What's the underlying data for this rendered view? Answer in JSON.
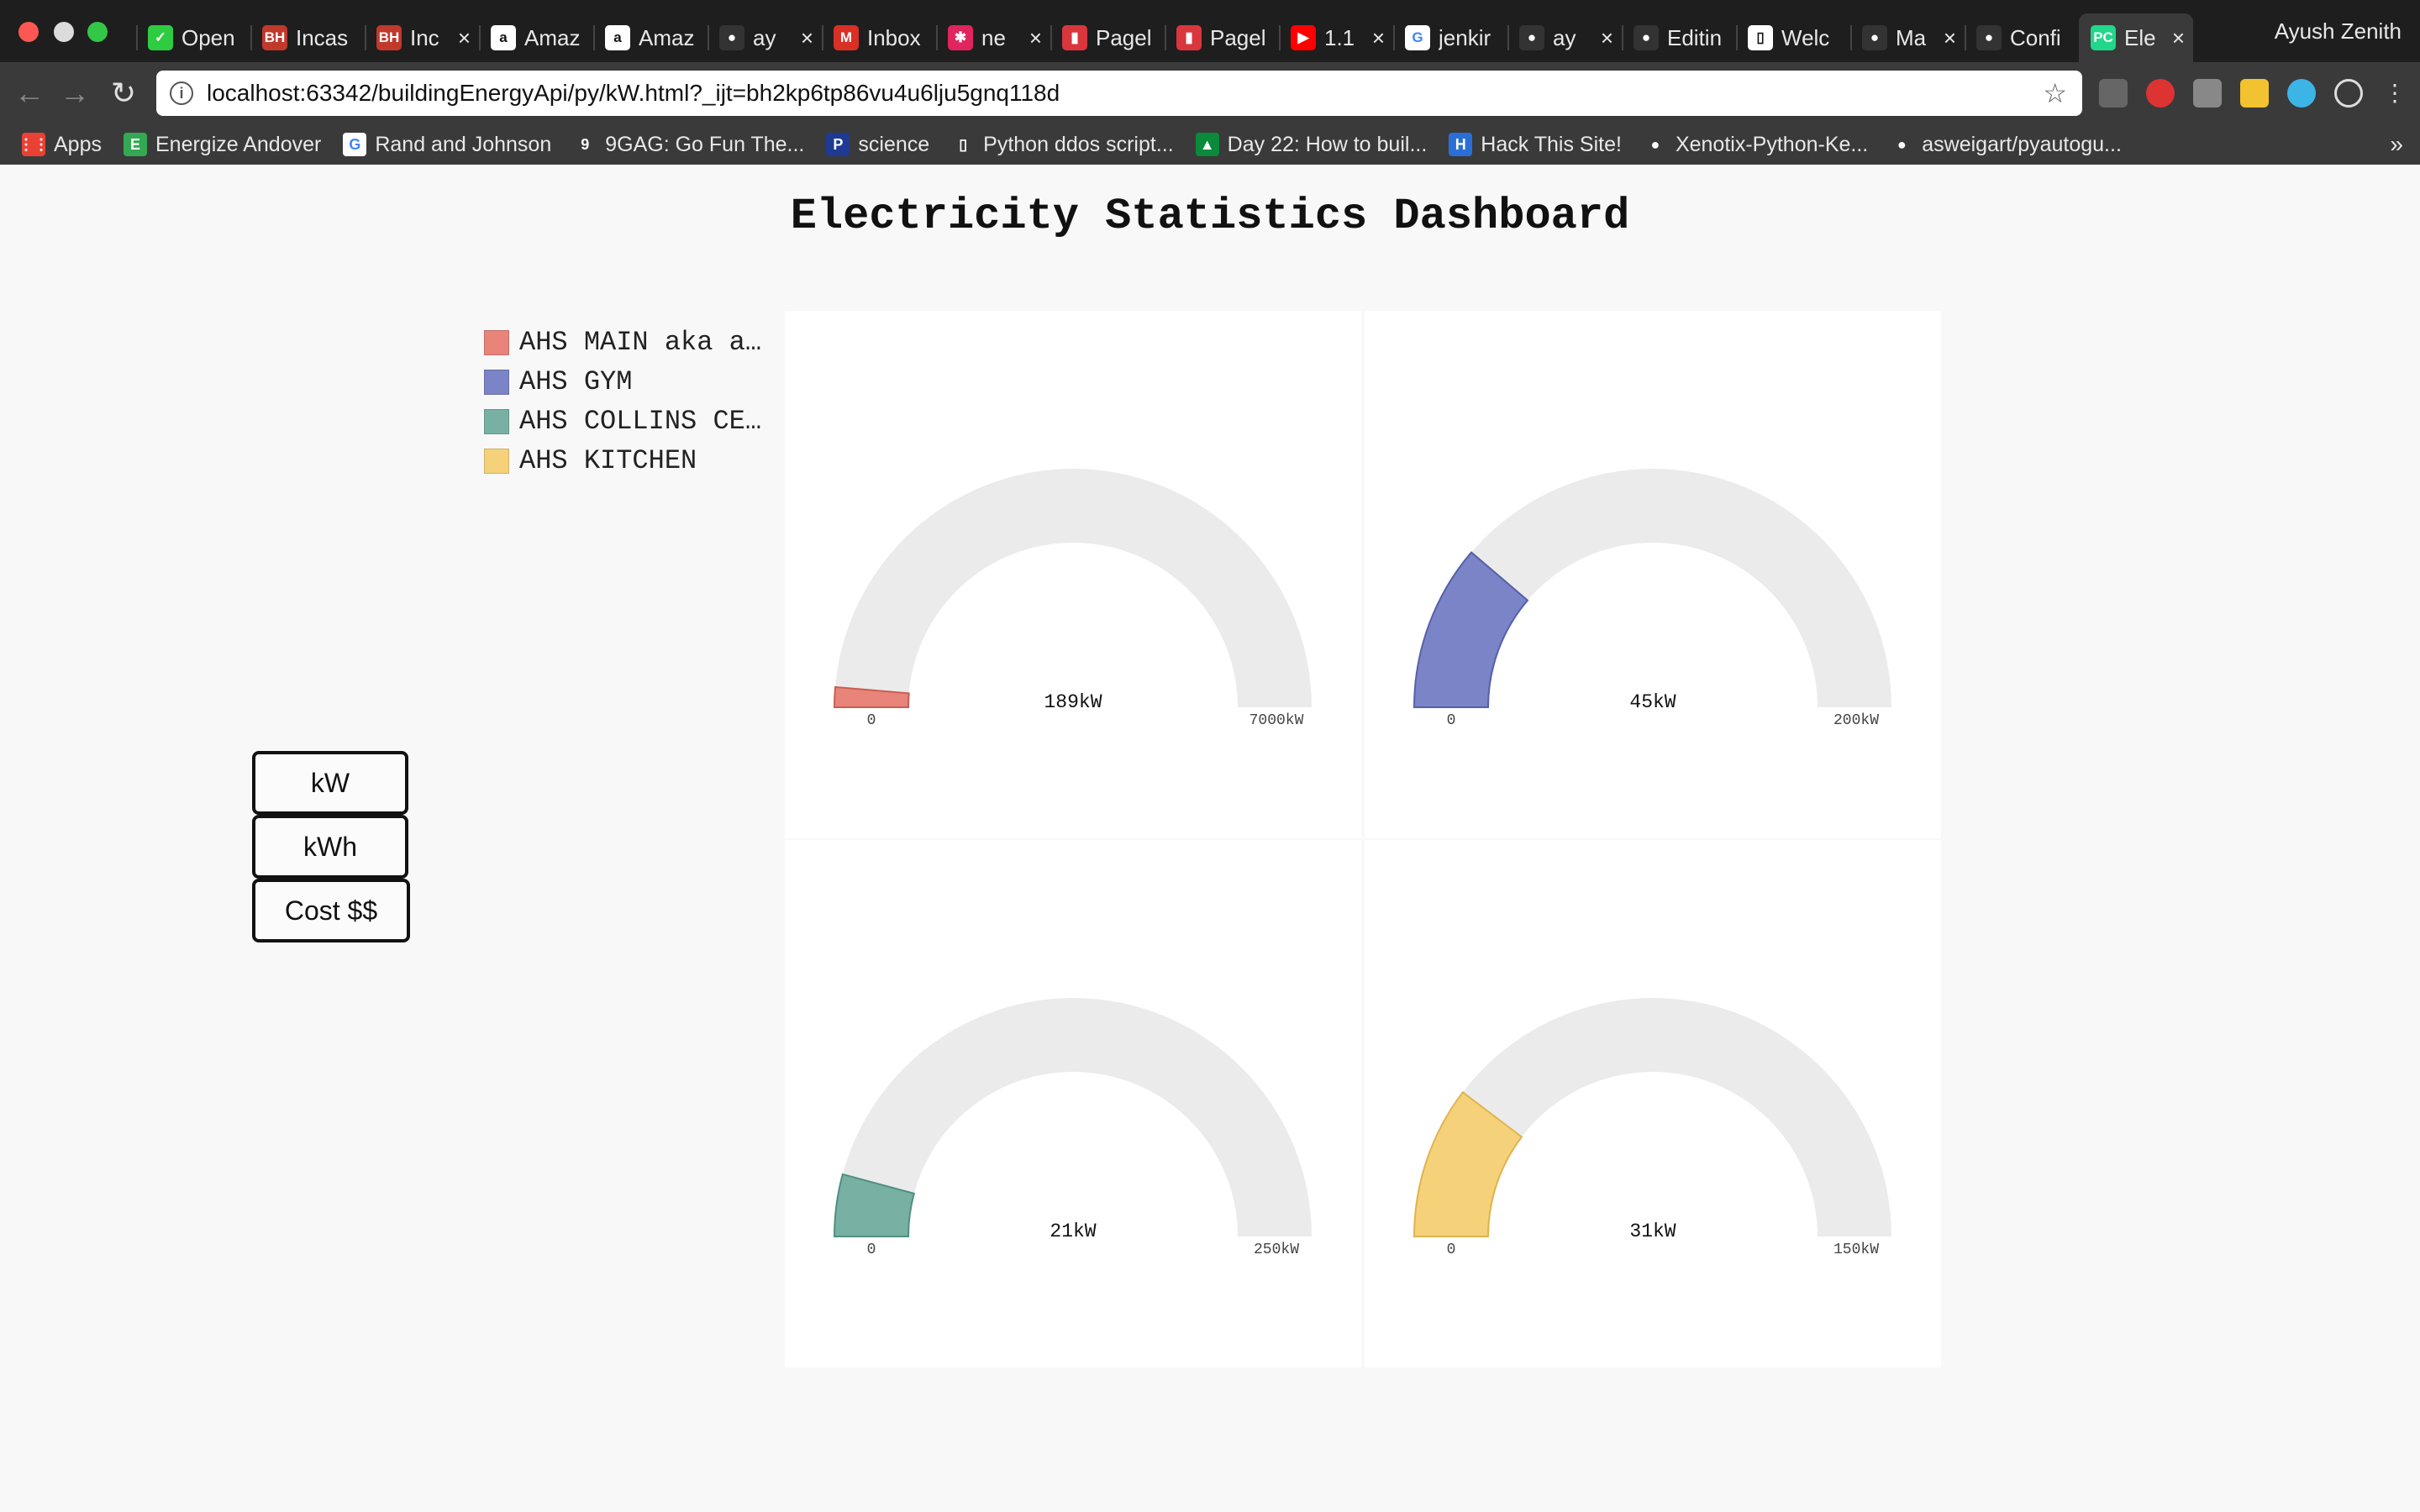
{
  "browser": {
    "tabs": [
      {
        "title": "Open",
        "icon": "chevron-green-icon",
        "color": "#2ecc40",
        "closable": false
      },
      {
        "title": "Incas",
        "icon": "bh-icon",
        "color": "#c0392b",
        "closable": false
      },
      {
        "title": "Inc",
        "icon": "bh-icon",
        "color": "#c0392b",
        "closable": true
      },
      {
        "title": "Amaz",
        "icon": "amazon-icon",
        "color": "#ffffff",
        "closable": false
      },
      {
        "title": "Amaz",
        "icon": "amazon-icon",
        "color": "#ffffff",
        "closable": false
      },
      {
        "title": "ay",
        "icon": "github-icon",
        "color": "#333333",
        "closable": true
      },
      {
        "title": "Inbox",
        "icon": "gmail-icon",
        "color": "#d93025",
        "closable": false
      },
      {
        "title": "ne",
        "icon": "brain-icon",
        "color": "#e0245e",
        "closable": true
      },
      {
        "title": "Pagel",
        "icon": "pagely-icon",
        "color": "#d9363e",
        "closable": false
      },
      {
        "title": "Pagel",
        "icon": "pagely-icon",
        "color": "#d9363e",
        "closable": false
      },
      {
        "title": "1.1",
        "icon": "youtube-icon",
        "color": "#ff0000",
        "closable": true
      },
      {
        "title": "jenkir",
        "icon": "google-icon",
        "color": "#4285f4",
        "closable": false
      },
      {
        "title": "ay",
        "icon": "github-icon",
        "color": "#333333",
        "closable": true
      },
      {
        "title": "Editin",
        "icon": "github-icon",
        "color": "#333333",
        "closable": false
      },
      {
        "title": "Welc",
        "icon": "page-icon",
        "color": "#cccccc",
        "closable": false
      },
      {
        "title": "Ma",
        "icon": "github-icon",
        "color": "#333333",
        "closable": true
      },
      {
        "title": "Confi",
        "icon": "github-icon",
        "color": "#333333",
        "closable": false
      },
      {
        "title": "Ele",
        "icon": "pycharm-icon",
        "color": "#21d789",
        "closable": true,
        "active": true
      }
    ],
    "profile": "Ayush Zenith",
    "url": "localhost:63342/buildingEnergyApi/py/kW.html?_ijt=bh2kp6tp86vu4u6lju5gnq118d",
    "bookmarks": [
      {
        "label": "Apps",
        "icon": "apps-grid-icon",
        "color": "#e94235"
      },
      {
        "label": "Energize Andover",
        "icon": "energize-icon",
        "color": "#34a853"
      },
      {
        "label": "Rand and Johnson",
        "icon": "google-icon",
        "color": "#4285f4"
      },
      {
        "label": "9GAG: Go Fun The...",
        "icon": "9gag-icon",
        "color": "#3a3a3a"
      },
      {
        "label": "science",
        "icon": "p-icon",
        "color": "#1f3a93"
      },
      {
        "label": "Python ddos script...",
        "icon": "page-icon",
        "color": "#3a3a3a"
      },
      {
        "label": "Day 22: How to buil...",
        "icon": "chart-icon",
        "color": "#0a8a3a"
      },
      {
        "label": "Hack This Site!",
        "icon": "hts-icon",
        "color": "#2a6fd6"
      },
      {
        "label": "Xenotix-Python-Ke...",
        "icon": "github-icon",
        "color": "#3a3a3a"
      },
      {
        "label": "asweigart/pyautogu...",
        "icon": "github-icon",
        "color": "#3a3a3a"
      }
    ],
    "bookmarks_more": "»"
  },
  "dashboard": {
    "title": "Electricity Statistics Dashboard",
    "legend": [
      {
        "label": "AHS MAIN aka a…",
        "color": "#e8847a"
      },
      {
        "label": "AHS GYM",
        "color": "#7a84c6"
      },
      {
        "label": "AHS COLLINS CE…",
        "color": "#78b0a4"
      },
      {
        "label": "AHS KITCHEN",
        "color": "#f5d17a"
      }
    ],
    "unit_buttons": {
      "kw": "kW",
      "kwh": "kWh",
      "cost": "Cost $$"
    },
    "gauges": [
      {
        "value": 189,
        "max": 7000,
        "value_label": "189kW",
        "min_label": "0",
        "max_label": "7000kW",
        "color": "#e8847a",
        "stroke": "#c95d52"
      },
      {
        "value": 45,
        "max": 200,
        "value_label": "45kW",
        "min_label": "0",
        "max_label": "200kW",
        "color": "#7a84c6",
        "stroke": "#5561a8"
      },
      {
        "value": 21,
        "max": 250,
        "value_label": "21kW",
        "min_label": "0",
        "max_label": "250kW",
        "color": "#78b0a4",
        "stroke": "#4f8f82"
      },
      {
        "value": 31,
        "max": 150,
        "value_label": "31kW",
        "min_label": "0",
        "max_label": "150kW",
        "color": "#f5d17a",
        "stroke": "#e0b44e"
      }
    ]
  }
}
